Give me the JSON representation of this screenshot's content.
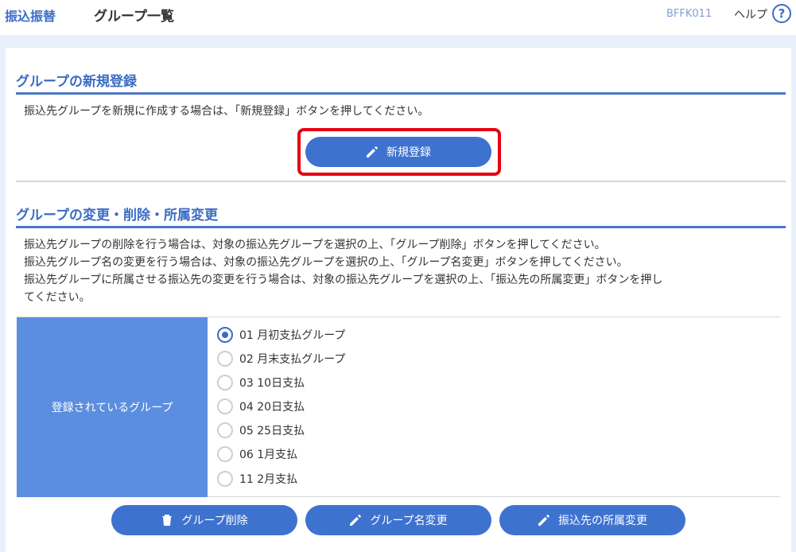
{
  "header": {
    "brand": "振込振替",
    "title": "グループ一覧",
    "screen_id": "BFFK011",
    "help_label": "ヘルプ",
    "help_icon": "?"
  },
  "new_section": {
    "title": "グループの新規登録",
    "description": "振込先グループを新規に作成する場合は、「新規登録」ボタンを押してください。",
    "button_label": "新規登録"
  },
  "edit_section": {
    "title": "グループの変更・削除・所属変更",
    "lines": [
      "振込先グループの削除を行う場合は、対象の振込先グループを選択の上、「グループ削除」ボタンを押してください。",
      "振込先グループ名の変更を行う場合は、対象の振込先グループを選択の上、「グループ名変更」ボタンを押してください。",
      "振込先グループに所属させる振込先の変更を行う場合は、対象の振込先グループを選択の上、「振込先の所属変更」ボタンを押し",
      "てください。"
    ],
    "table_label": "登録されているグループ",
    "groups": [
      {
        "label": "01 月初支払グループ",
        "selected": true
      },
      {
        "label": "02 月末支払グループ",
        "selected": false
      },
      {
        "label": "03 10日支払",
        "selected": false
      },
      {
        "label": "04 20日支払",
        "selected": false
      },
      {
        "label": "05 25日支払",
        "selected": false
      },
      {
        "label": "06 1月支払",
        "selected": false
      },
      {
        "label": "11 2月支払",
        "selected": false
      }
    ],
    "buttons": {
      "delete": "グループ削除",
      "rename": "グループ名変更",
      "membership": "振込先の所属変更"
    }
  },
  "colors": {
    "accent": "#3b6cc5",
    "button": "#3e72cf",
    "table_label_bg": "#5b8ee0",
    "highlight": "#e60012"
  }
}
